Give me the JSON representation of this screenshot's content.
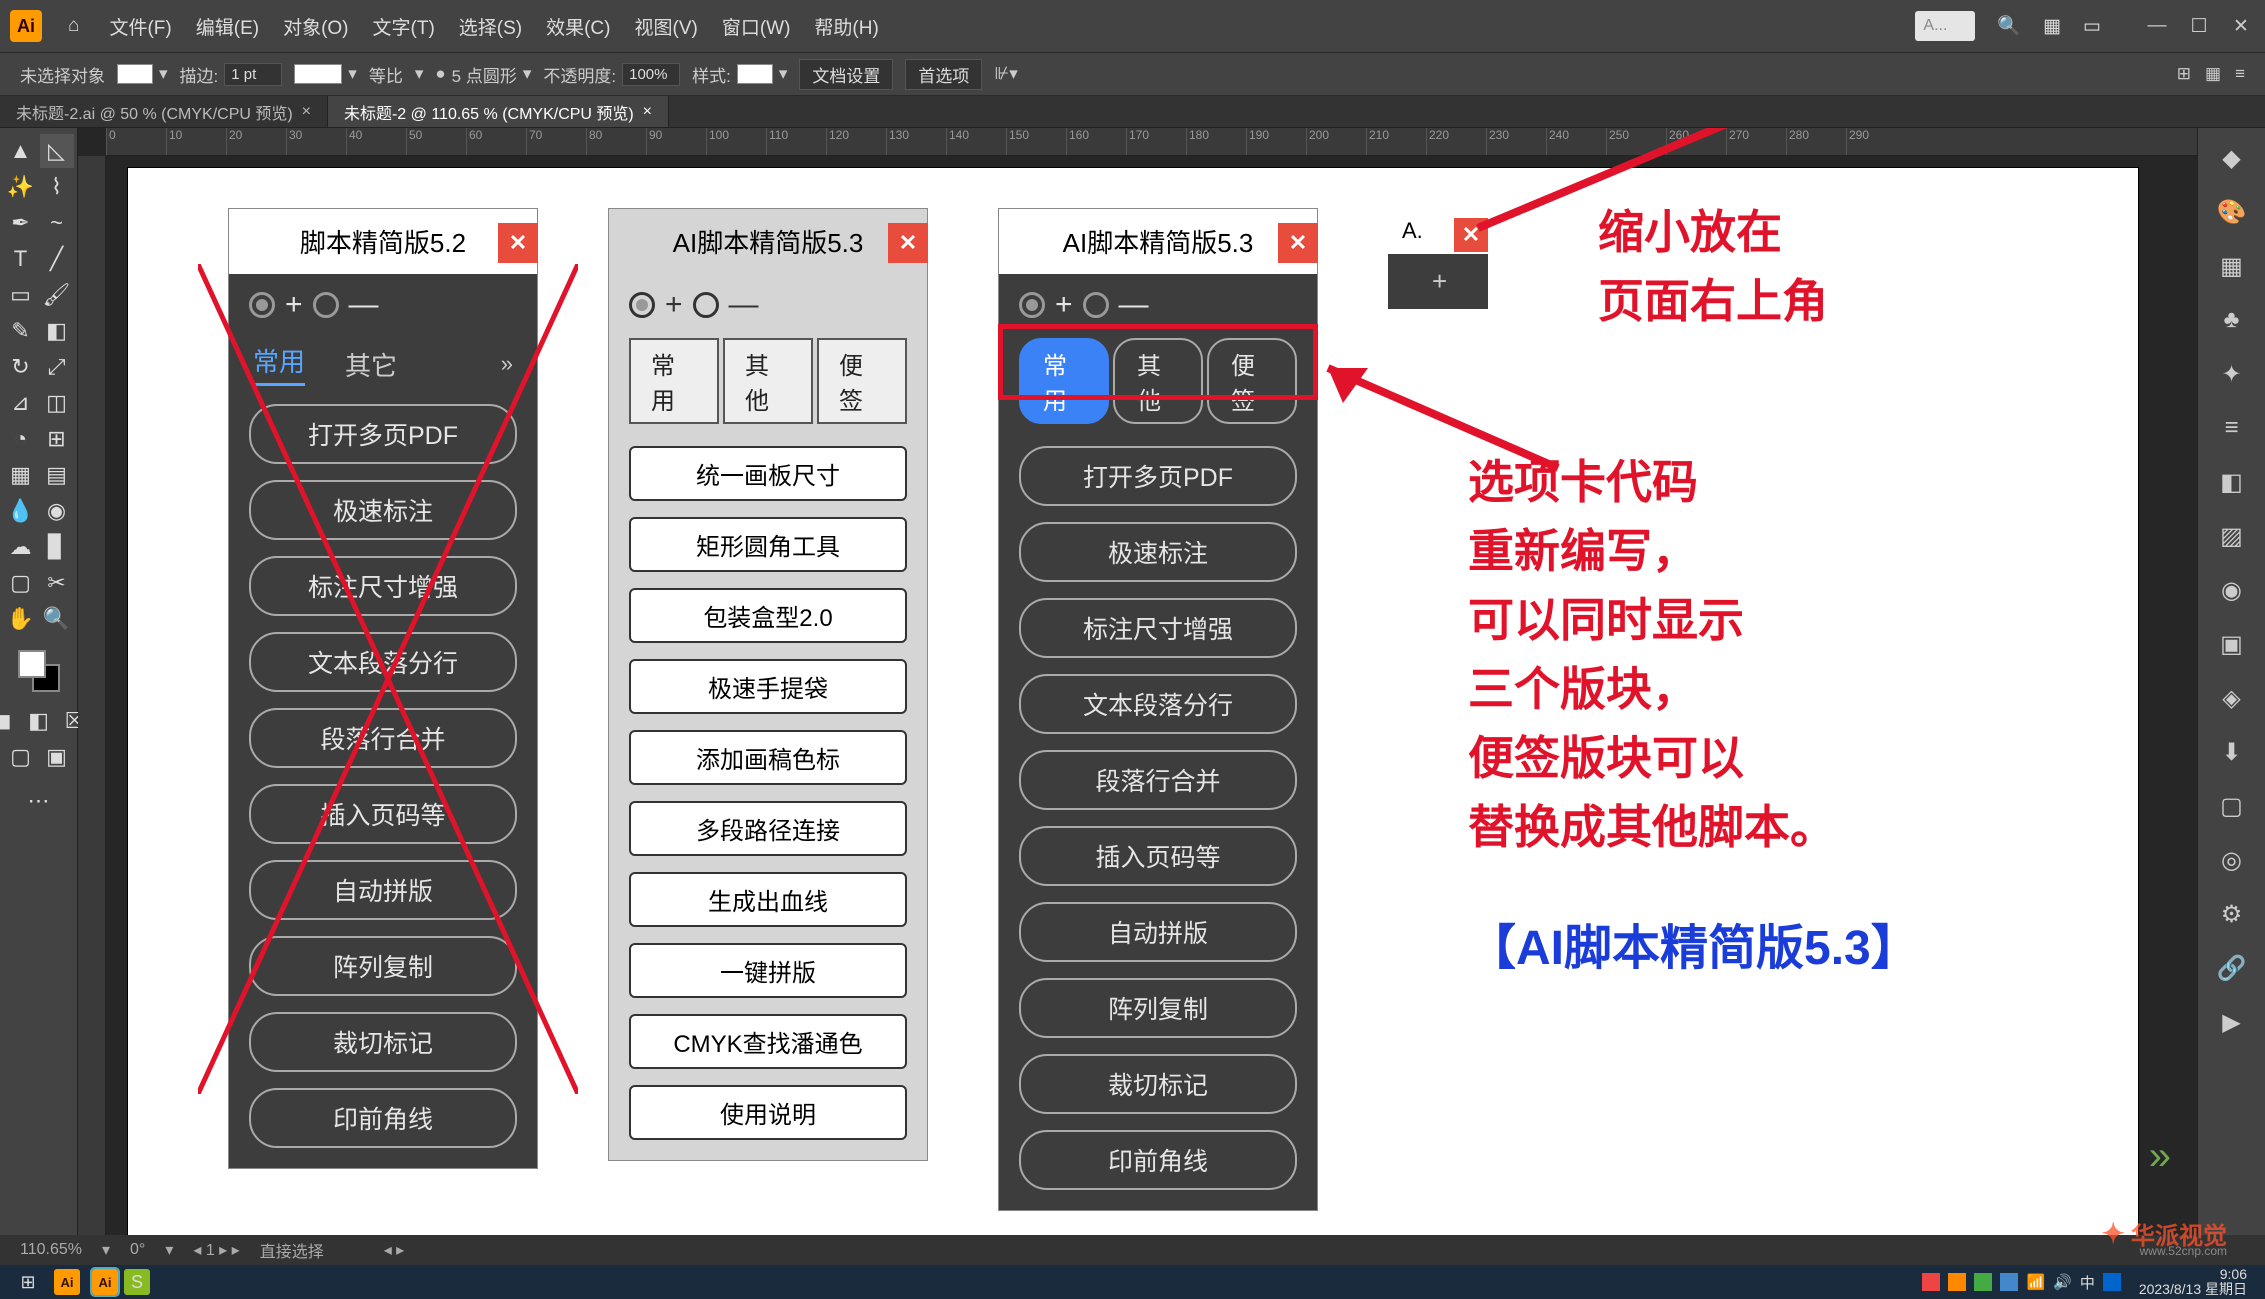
{
  "menubar": {
    "items": [
      "文件(F)",
      "编辑(E)",
      "对象(O)",
      "文字(T)",
      "选择(S)",
      "效果(C)",
      "视图(V)",
      "窗口(W)",
      "帮助(H)"
    ],
    "search_placeholder": "A..."
  },
  "controlbar": {
    "no_selection": "未选择对象",
    "stroke_label": "描边:",
    "stroke_value": "1 pt",
    "uniform": "等比",
    "corner_label": "5 点圆形",
    "opacity_label": "不透明度:",
    "opacity_value": "100%",
    "style_label": "样式:",
    "doc_setup": "文档设置",
    "prefs": "首选项"
  },
  "tabs": [
    "未标题-2.ai @ 50 % (CMYK/CPU 预览)",
    "未标题-2 @ 110.65 % (CMYK/CPU 预览)"
  ],
  "ruler_marks": [
    "0",
    "10",
    "20",
    "30",
    "40",
    "50",
    "60",
    "70",
    "80",
    "90",
    "100",
    "110",
    "120",
    "130",
    "140",
    "150",
    "160",
    "170",
    "180",
    "190",
    "200",
    "210",
    "220",
    "230",
    "240",
    "250",
    "260",
    "270",
    "280",
    "290"
  ],
  "panel52": {
    "title": "脚本精简版5.2",
    "tab_active": "常用",
    "tab_other": "其它",
    "buttons": [
      "打开多页PDF",
      "极速标注",
      "标注尺寸增强",
      "文本段落分行",
      "段落行合并",
      "插入页码等",
      "自动拼版",
      "阵列复制",
      "裁切标记",
      "印前角线"
    ]
  },
  "panel53_light": {
    "title": "AI脚本精简版5.3",
    "tabs": [
      "常用",
      "其他",
      "便签"
    ],
    "buttons": [
      "统一画板尺寸",
      "矩形圆角工具",
      "包装盒型2.0",
      "极速手提袋",
      "添加画稿色标",
      "多段路径连接",
      "生成出血线",
      "一键拼版",
      "CMYK查找潘通色",
      "使用说明"
    ]
  },
  "panel53_dark": {
    "title": "AI脚本精简版5.3",
    "tabs": [
      "常用",
      "其他",
      "便签"
    ],
    "buttons": [
      "打开多页PDF",
      "极速标注",
      "标注尺寸增强",
      "文本段落分行",
      "段落行合并",
      "插入页码等",
      "自动拼版",
      "阵列复制",
      "裁切标记",
      "印前角线"
    ]
  },
  "mini_panel": {
    "title": "A."
  },
  "annotations": {
    "top": "缩小放在\n页面右上角",
    "middle": "选项卡代码\n重新编写，\n可以同时显示\n三个版块，\n便签版块可以\n替换成其他脚本。",
    "blue": "【AI脚本精简版5.3】"
  },
  "statusbar": {
    "zoom": "110.65%",
    "rotate": "0°",
    "nav": "1",
    "tool": "直接选择"
  },
  "taskbar": {
    "time": "9:06",
    "date": "2023/8/13 星期日"
  },
  "watermark": {
    "brand": "华派视觉",
    "url": "www.52cnp.com"
  }
}
